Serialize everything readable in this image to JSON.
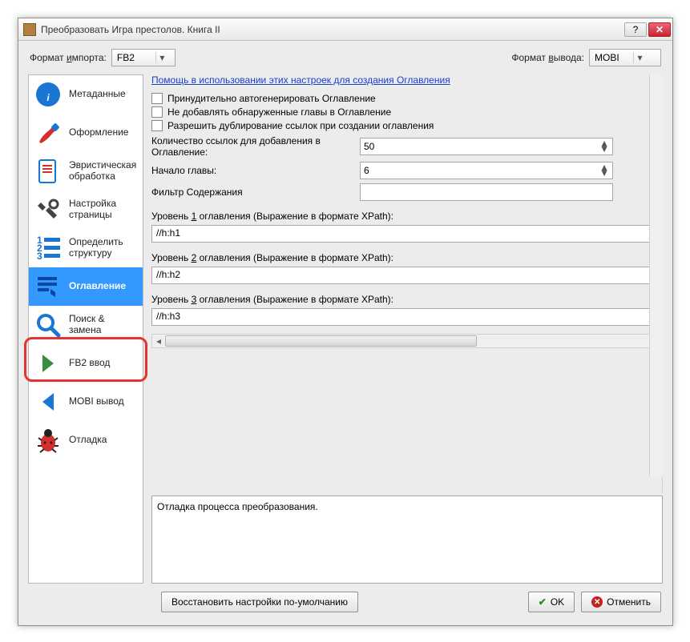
{
  "window": {
    "title": "Преобразовать Игра престолов. Книга II"
  },
  "topbar": {
    "import_label_pre": "Формат ",
    "import_label_u": "и",
    "import_label_post": "мпорта:",
    "import_value": "FB2",
    "output_label_pre": "Формат ",
    "output_label_u": "в",
    "output_label_post": "ывода:",
    "output_value": "MOBI"
  },
  "sidebar": {
    "items": [
      {
        "label": "Метаданные"
      },
      {
        "label": "Оформление"
      },
      {
        "label": "Эвристическая обработка"
      },
      {
        "label": "Настройка страницы"
      },
      {
        "label": "Определить структуру"
      },
      {
        "label": "Оглавление"
      },
      {
        "label": "Поиск & замена"
      },
      {
        "label": "FB2 ввод"
      },
      {
        "label": "MOBI вывод"
      },
      {
        "label": "Отладка"
      }
    ]
  },
  "content": {
    "help_link": "Помощь в использовании этих настроек для создания Оглавления",
    "cb_force": "Принудительно автогенерировать Оглавление",
    "cb_nodup": "Не добавлять обнаруженные главы в Оглавление",
    "cb_allowdup": "Разрешить дублирование ссылок при создании оглавления",
    "links_label": "Количество ссылок для добавления в Оглавление:",
    "links_value": "50",
    "chapter_label": "Начало главы:",
    "chapter_value": "6",
    "filter_label": "Фильтр Содержания",
    "filter_value": "",
    "lvl1_pre": "Уровень ",
    "lvl1_u": "1",
    "lvl1_post": " оглавления (Выражение в формате XPath):",
    "lvl1_value": "//h:h1",
    "lvl2_pre": "Уровень ",
    "lvl2_u": "2",
    "lvl2_post": " оглавления (Выражение в формате XPath):",
    "lvl2_value": "//h:h2",
    "lvl3_pre": "Уровень ",
    "lvl3_u": "3",
    "lvl3_post": " оглавления (Выражение в формате XPath):",
    "lvl3_value": "//h:h3",
    "debug_text": "Отладка процесса преобразования."
  },
  "footer": {
    "restore": "Восстановить настройки по-умолчанию",
    "ok": "OK",
    "cancel": "Отменить"
  }
}
